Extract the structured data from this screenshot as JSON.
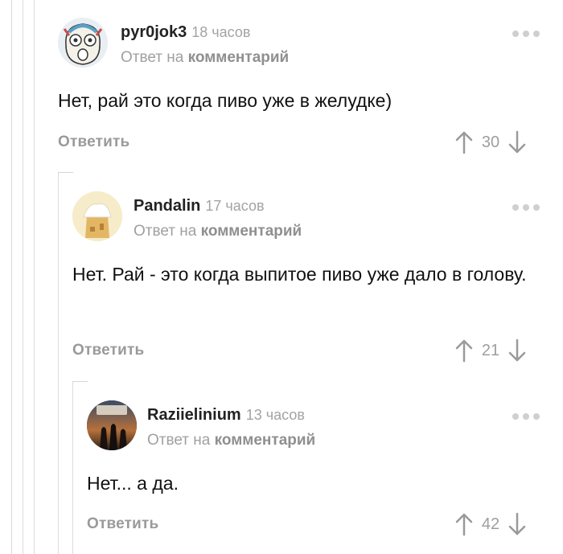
{
  "comments": [
    {
      "author": "pyr0jok3",
      "time": "18 часов",
      "reply_prefix": "Ответ на",
      "reply_link": "комментарий",
      "text": "Нет, рай это когда пиво уже в желудке)",
      "reply_label": "Ответить",
      "rating": "30",
      "avatar_icon": "cartoon-face-avatar"
    },
    {
      "author": "Pandalin",
      "time": "17 часов",
      "reply_prefix": "Ответ на",
      "reply_link": "комментарий",
      "text": "Нет. Рай - это когда выпитое пиво уже дало в голову.",
      "reply_label": "Ответить",
      "rating": "21",
      "avatar_icon": "house-avatar"
    },
    {
      "author": "Raziielinium",
      "time": "13 часов",
      "reply_prefix": "Ответ на",
      "reply_link": "комментарий",
      "text": "Нет... а да.",
      "reply_label": "Ответить",
      "rating": "42",
      "avatar_icon": "game-poster-avatar"
    }
  ],
  "colors": {
    "meta_gray": "#a0a0a0",
    "thread_line": "#dcdcdc"
  }
}
